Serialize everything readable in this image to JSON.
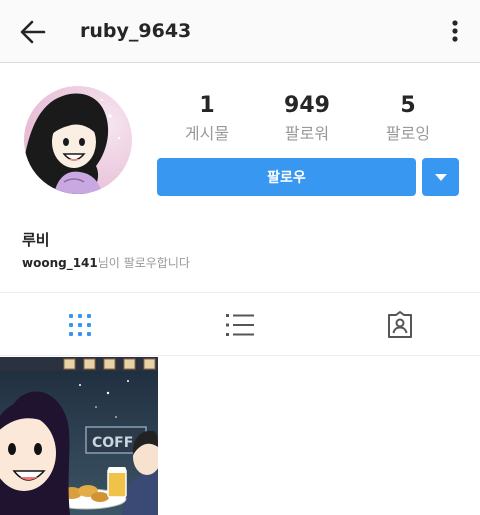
{
  "header": {
    "username": "ruby_9643"
  },
  "stats": [
    {
      "value": "1",
      "label": "게시물"
    },
    {
      "value": "949",
      "label": "팔로워"
    },
    {
      "value": "5",
      "label": "팔로잉"
    }
  ],
  "actions": {
    "follow_label": "팔로우"
  },
  "profile": {
    "display_name": "루비",
    "followed_by_user": "woong_141",
    "followed_by_suffix": "님이 팔로우합니다"
  },
  "post_thumbnail": {
    "sign_text": "COFF"
  },
  "colors": {
    "accent": "#3897f0",
    "secondary_text": "#999999",
    "divider": "#dbdbdb"
  },
  "icons": {
    "back": "arrow-left-icon",
    "more": "more-vertical-icon",
    "dropdown": "caret-down-icon",
    "grid_tab": "grid-icon",
    "list_tab": "list-icon",
    "tagged_tab": "tagged-person-icon"
  }
}
